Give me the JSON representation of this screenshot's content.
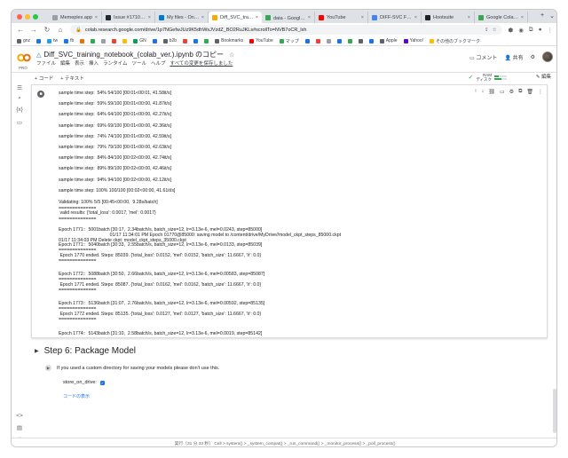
{
  "browser": {
    "tabs": [
      {
        "title": "Memeplex.app",
        "color": "#9aa0a6",
        "active": false
      },
      {
        "title": "Issue #1710 · CorentinJ/...",
        "color": "#24292f",
        "active": false
      },
      {
        "title": "My files - OneDrive",
        "color": "#0078d4",
        "active": false
      },
      {
        "title": "Diff_SVC_training_noteb...",
        "color": "#f9ab00",
        "active": true
      },
      {
        "title": "data - Google ドライブ",
        "color": "#34a853",
        "active": false
      },
      {
        "title": "YouTube",
        "color": "#ff0000",
        "active": false
      },
      {
        "title": "DIFF-SVC FOR V...",
        "color": "#4285f4",
        "active": false
      },
      {
        "title": "Hootsuite",
        "color": "#202124",
        "active": false
      },
      {
        "title": "Google Colab V...",
        "color": "#34a853",
        "active": false
      }
    ],
    "url": "colab.research.google.com/drive/1p7NGefwJUz9K5dhWsJVzdZ_BO2RuJKLs#scrollTo=NVB7oCR_lxh",
    "bookmarks": [
      {
        "label": "gnz",
        "color": "#5f6368"
      },
      {
        "label": "",
        "color": "#1a73e8"
      },
      {
        "label": "tw",
        "color": "#1da1f2"
      },
      {
        "label": "fb",
        "color": "#1877f2"
      },
      {
        "label": "",
        "color": "#e8710a"
      },
      {
        "label": "",
        "color": "#34a853"
      },
      {
        "label": "",
        "color": "#9aa0a6"
      },
      {
        "label": "",
        "color": "#ea4335"
      },
      {
        "label": "",
        "color": "#fbbc04"
      },
      {
        "label": "GN",
        "color": "#0f9d58"
      },
      {
        "label": "",
        "color": "#1a73e8"
      },
      {
        "label": "b2b",
        "color": "#5f6368"
      },
      {
        "label": "",
        "color": "#ea4335"
      },
      {
        "label": "",
        "color": "#1a73e8"
      },
      {
        "label": "",
        "color": "#34a853"
      },
      {
        "label": "Bookmarks",
        "color": "#5f6368"
      },
      {
        "label": "YouTube",
        "color": "#ff0000"
      },
      {
        "label": "マップ",
        "color": "#34a853"
      },
      {
        "label": "",
        "color": "#1a73e8"
      },
      {
        "label": "",
        "color": "#ea4335"
      },
      {
        "label": "",
        "color": "#9aa0a6"
      },
      {
        "label": "",
        "color": "#1a73e8"
      },
      {
        "label": "",
        "color": "#34a853"
      },
      {
        "label": "",
        "color": "#5f6368"
      },
      {
        "label": "",
        "color": "#1a73e8"
      },
      {
        "label": "Apple",
        "color": "#5f6368"
      },
      {
        "label": "Yahoo!",
        "color": "#6001d2"
      },
      {
        "label": "その他のブックマーク",
        "color": "#fbbc04"
      }
    ]
  },
  "colab": {
    "notebook_title": "Diff_SVC_training_notebook_(colab_ver.).ipynb のコピー",
    "pro_label": "PRO",
    "menus": [
      "ファイル",
      "編集",
      "表示",
      "挿入",
      "ランタイム",
      "ツール",
      "ヘルプ"
    ],
    "saved_text": "すべての変更を保存しました",
    "comment_label": "コメント",
    "share_label": "共有",
    "add_code": "+ コード",
    "add_text": "+ テキスト",
    "ram_label": "RAM",
    "disk_label": "ディスク",
    "ram_usage": 0.35,
    "disk_usage": 0.55,
    "edit_label": "編集"
  },
  "output_lines": [
    "sample time step:  54% 54/100 [00:01<00:01, 41.58it/s]",
    "sample time step:  59% 59/100 [00:01<00:00, 41.87it/s]",
    "sample time step:  64% 64/100 [00:01<00:00, 42.27it/s]",
    "sample time step:  69% 69/100 [00:01<00:00, 42.36it/s]",
    "sample time step:  74% 74/100 [00:01<00:00, 42.59it/s]",
    "sample time step:  79% 79/100 [00:01<00:00, 42.63it/s]",
    "sample time step:  84% 84/100 [00:02<00:00, 42.74it/s]",
    "sample time step:  89% 89/100 [00:02<00:00, 42.46it/s]",
    "sample time step:  94% 94/100 [00:02<00:00, 42.12it/s]",
    "sample time step: 100% 100/100 [00:02<00:00, 41.61it/s]",
    "Validating: 100% 5/5 [00:45<00:00,  9.28s/batch]",
    "==============",
    " valid results: {'total_loss': 0.0017, 'mel': 0.0017}",
    "==============",
    "Epoch 1771::  5001batch [30:17,  2.34batch/s, batch_size=12, lr=3.13e-6, mel=0.0243, step=85000]",
    "                                        01/17 11:34:01 PM Epoch 01770@85000: saving model to /content/drive/MyDrive//model_ckpt_steps_85000.ckpt",
    "01/17 11:34:03 PM Delete ckpt: model_ckpt_steps_35000.ckpt",
    "Epoch 1771::  5040batch [30:33,  2.55batch/s, batch_size=12, lr=3.13e-6, mel=0.0133, step=85039]",
    "==============",
    " Epoch 1770 ended. Steps: 85039. {'total_loss': 0.0152, 'mel': 0.0152, 'batch_size': 11.6667, 'lr': 0.0}",
    "==============",
    "Epoch 1772::  5088batch [30:50,  2.66batch/s, batch_size=12, lr=3.13e-6, mel=0.00583, step=85087]",
    "==============",
    " Epoch 1771 ended. Steps: 85087. {'total_loss': 0.0162, 'mel': 0.0162, 'batch_size': 11.6667, 'lr': 0.0}",
    "==============",
    "Epoch 1773::  5136batch [31:07,  2.76batch/s, batch_size=12, lr=3.13e-6, mel=0.00592, step=85135]",
    "==============",
    " Epoch 1772 ended. Steps: 85135. {'total_loss': 0.0127, 'mel': 0.0127, 'batch_size': 11.6667, 'lr': 0.0}",
    "==============",
    "Epoch 1774::  5143batch [31:10,  2.58batch/s, batch_size=12, lr=3.13e-6, mel=0.0019, step=85142]"
  ],
  "section": {
    "heading": "Step 6: Package Model",
    "text_cell": "If you used a custom directory for saving your models please don't use this.",
    "field_label": "store_on_drive:",
    "show_code": "コードの表示"
  },
  "status_bar": "実行（31 分 33 秒）  Cell > system() > _system_compat() > _run_command() > _monitor_process() > _poll_process()"
}
